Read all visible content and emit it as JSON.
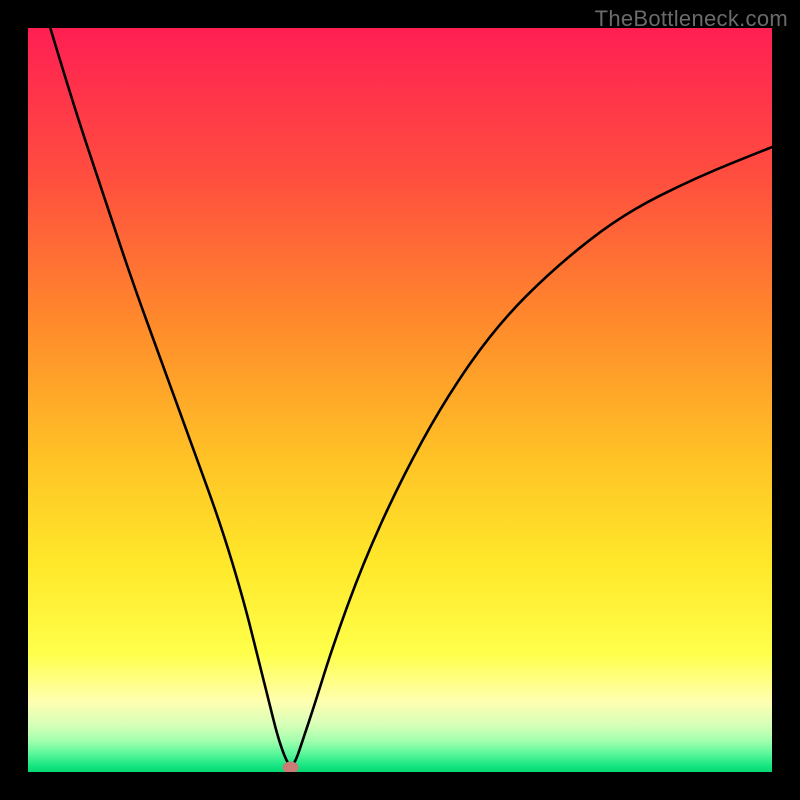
{
  "watermark": "TheBottleneck.com",
  "chart_data": {
    "type": "line",
    "title": "",
    "xlabel": "",
    "ylabel": "",
    "xlim": [
      0,
      100
    ],
    "ylim": [
      0,
      100
    ],
    "grid": false,
    "series": [
      {
        "name": "bottleneck-curve",
        "x": [
          3,
          6,
          10,
          14,
          18,
          22,
          26,
          29,
          31,
          32.5,
          33.5,
          34.5,
          35.3,
          36,
          37,
          38.5,
          41,
          45,
          50,
          56,
          63,
          71,
          80,
          90,
          100
        ],
        "values": [
          100,
          90,
          78,
          66,
          55,
          44,
          33,
          23,
          15,
          9,
          5,
          2,
          0.6,
          1.5,
          4.5,
          9,
          17,
          28,
          39,
          50,
          60,
          68,
          75,
          80,
          84
        ]
      }
    ],
    "marker": {
      "x": 35.3,
      "y": 0.6,
      "color": "#c97d74",
      "rx": 8,
      "ry": 6
    },
    "background_gradient": {
      "stops": [
        {
          "offset": 0.0,
          "color": "#ff1f53"
        },
        {
          "offset": 0.2,
          "color": "#ff4e3f"
        },
        {
          "offset": 0.4,
          "color": "#ff8b2b"
        },
        {
          "offset": 0.58,
          "color": "#ffc326"
        },
        {
          "offset": 0.72,
          "color": "#ffe82a"
        },
        {
          "offset": 0.84,
          "color": "#ffff4a"
        },
        {
          "offset": 0.905,
          "color": "#ffffb0"
        },
        {
          "offset": 0.935,
          "color": "#d9ffb8"
        },
        {
          "offset": 0.958,
          "color": "#a3ffae"
        },
        {
          "offset": 0.975,
          "color": "#5cf79b"
        },
        {
          "offset": 0.992,
          "color": "#16e582"
        },
        {
          "offset": 1.0,
          "color": "#05d872"
        }
      ]
    }
  }
}
